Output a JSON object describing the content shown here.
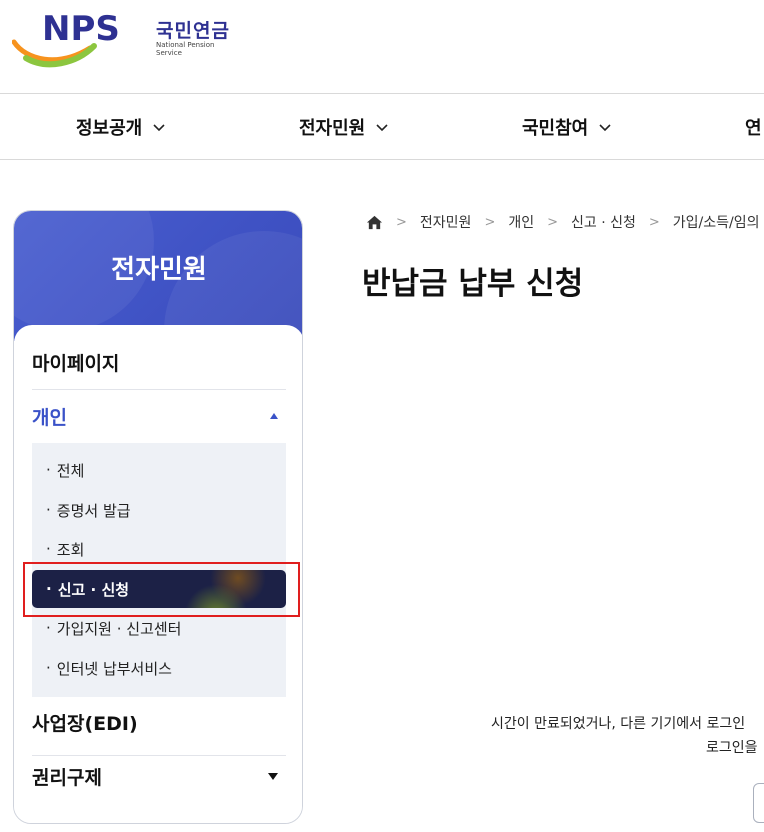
{
  "logo": {
    "brand": "NPS",
    "korean_name": "국민연금",
    "english_name": "National Pension Service",
    "colors": {
      "navy": "#2e3192",
      "orange": "#f7931e",
      "green": "#8cc63f"
    }
  },
  "gnb": {
    "items": [
      {
        "label": "정보공개"
      },
      {
        "label": "전자민원"
      },
      {
        "label": "국민참여"
      },
      {
        "label": "연"
      }
    ]
  },
  "sidebar": {
    "title": "전자민원",
    "menu": [
      {
        "label": "마이페이지"
      },
      {
        "label": "개인",
        "expanded": true
      },
      {
        "label": "사업장(EDI)"
      },
      {
        "label": "권리구제",
        "expanded": false
      }
    ],
    "submenu": [
      {
        "label": "전체"
      },
      {
        "label": "증명서 발급"
      },
      {
        "label": "조회"
      },
      {
        "label": "신고 · 신청",
        "active": true
      },
      {
        "label": "가입지원 · 신고센터"
      },
      {
        "label": "인터넷 납부서비스"
      }
    ],
    "colors": {
      "header": "#4a5fd0",
      "active_bg": "#1c2146",
      "accent": "#3a52c8",
      "highlight_border": "#e01e1e"
    }
  },
  "breadcrumb": {
    "items": [
      "전자민원",
      "개인",
      "신고 · 신청",
      "가입/소득/임의"
    ]
  },
  "page": {
    "title": "반납금 납부 신청"
  },
  "message": {
    "line1": "시간이 만료되었거나, 다른 기기에서 로그인",
    "line2": "로그인을"
  }
}
